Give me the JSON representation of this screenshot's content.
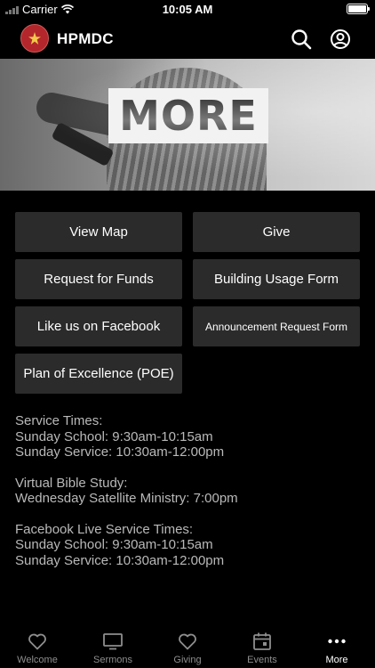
{
  "status_bar": {
    "carrier": "Carrier",
    "time": "10:05 AM"
  },
  "app_bar": {
    "title": "HPMDC",
    "icons": [
      "logo-emblem",
      "search-icon",
      "account-icon"
    ]
  },
  "hero": {
    "sign_text": "MORE"
  },
  "buttons": [
    {
      "label": "View Map"
    },
    {
      "label": "Give"
    },
    {
      "label": "Request for Funds"
    },
    {
      "label": "Building Usage Form"
    },
    {
      "label": "Like us on Facebook"
    },
    {
      "label": "Announcement Request Form"
    },
    {
      "label": "Plan of Excellence (POE)"
    }
  ],
  "info": {
    "service_times": {
      "heading": "Service Times:",
      "lines": [
        "Sunday School: 9:30am-10:15am",
        "Sunday Service: 10:30am-12:00pm"
      ]
    },
    "bible_study": {
      "heading": "Virtual Bible Study:",
      "lines": [
        "Wednesday Satellite Ministry: 7:00pm"
      ]
    },
    "facebook_live": {
      "heading": "Facebook Live Service Times:",
      "lines": [
        "Sunday School: 9:30am-10:15am",
        "Sunday Service: 10:30am-12:00pm"
      ]
    }
  },
  "tabs": [
    {
      "label": "Welcome",
      "icon": "heart-icon",
      "active": false
    },
    {
      "label": "Sermons",
      "icon": "monitor-icon",
      "active": false
    },
    {
      "label": "Giving",
      "icon": "heart-icon",
      "active": false
    },
    {
      "label": "Events",
      "icon": "calendar-icon",
      "active": false
    },
    {
      "label": "More",
      "icon": "more-dots-icon",
      "active": true
    }
  ],
  "colors": {
    "background": "#000000",
    "button_bg": "#2b2b2b",
    "info_text": "#b9b9b9",
    "tab_inactive": "#8e8e8e",
    "tab_active": "#ffffff",
    "logo_red": "#b3262b"
  }
}
